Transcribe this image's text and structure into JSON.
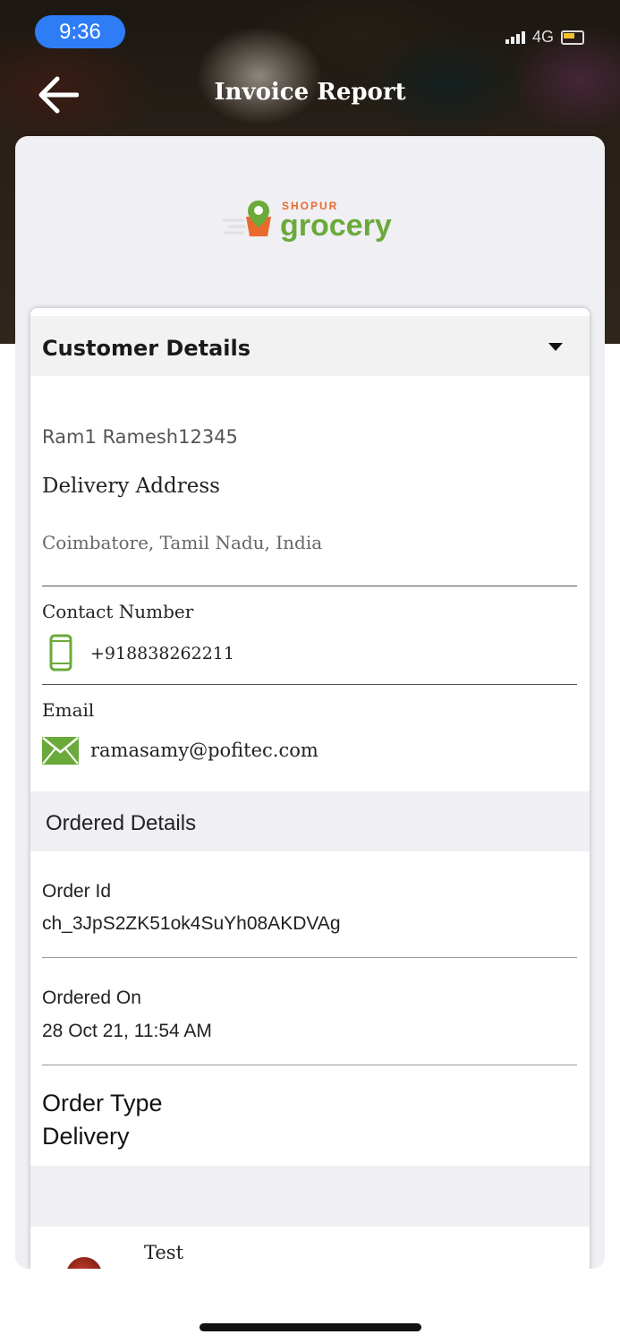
{
  "status_bar": {
    "time": "9:36",
    "network": "4G"
  },
  "header": {
    "title": "Invoice Report"
  },
  "logo": {
    "brand_top": "SHOPUR",
    "brand_main": "grocery"
  },
  "customer": {
    "section_title": "Customer Details",
    "name": "Ram1 Ramesh12345",
    "address_label": "Delivery Address",
    "address": "Coimbatore, Tamil Nadu, India",
    "contact_label": "Contact Number",
    "phone": "+918838262211",
    "email_label": "Email",
    "email": "ramasamy@pofitec.com"
  },
  "order": {
    "section_title": "Ordered Details",
    "id_label": "Order Id",
    "id": "ch_3JpS2ZK51ok4SuYh08AKDVAg",
    "ordered_on_label": "Ordered On",
    "ordered_on": "28 Oct 21, 11:54 AM",
    "type_label": "Order Type",
    "type": "Delivery"
  },
  "items": [
    {
      "name": "Test"
    }
  ],
  "colors": {
    "accent_green": "#6aaa3a",
    "logo_orange": "#ea6a2e",
    "time_pill": "#2f7df6"
  },
  "icons": {
    "back": "arrow-left-icon",
    "dropdown": "caret-down-icon",
    "phone": "mobile-phone-icon",
    "email": "envelope-icon"
  }
}
